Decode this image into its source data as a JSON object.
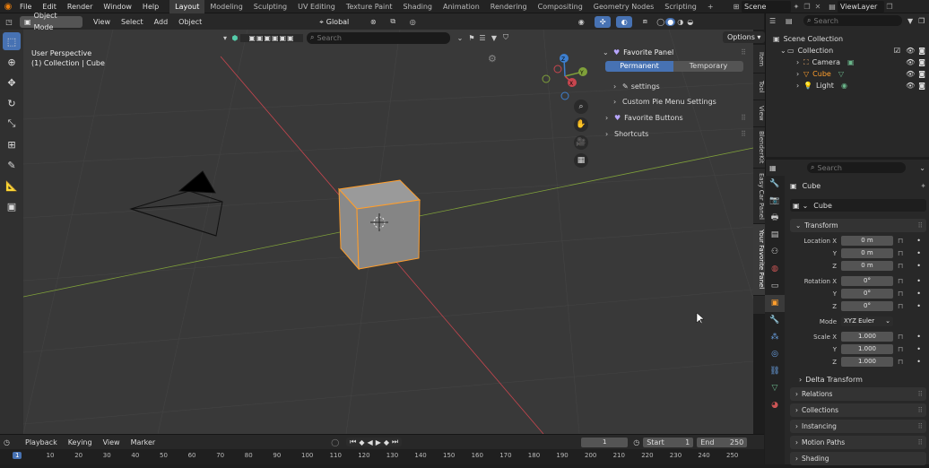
{
  "topbar": {
    "menus": [
      "File",
      "Edit",
      "Render",
      "Window",
      "Help"
    ],
    "workspaces": [
      "Layout",
      "Modeling",
      "Sculpting",
      "UV Editing",
      "Texture Paint",
      "Shading",
      "Animation",
      "Rendering",
      "Compositing",
      "Geometry Nodes",
      "Scripting"
    ],
    "active_workspace": "Layout",
    "plus": "+",
    "scene": "Scene",
    "view_layer": "ViewLayer"
  },
  "viewport_header": {
    "mode": "Object Mode",
    "menus": [
      "View",
      "Select",
      "Add",
      "Object"
    ],
    "orientation": "Global",
    "search_placeholder": "Search",
    "options": "Options"
  },
  "viewport": {
    "view_name": "User Perspective",
    "context": "(1) Collection | Cube",
    "gizmo_axes": [
      "X",
      "Y",
      "Z"
    ]
  },
  "favorite_panel": {
    "title": "Favorite Panel",
    "tabs": [
      "Permanent",
      "Temporary"
    ],
    "active_tab": "Permanent",
    "items": [
      "settings",
      "Custom Pie Menu Settings",
      "Favorite Buttons",
      "Shortcuts"
    ]
  },
  "side_tabs": [
    "Item",
    "Tool",
    "View",
    "BlenderKit",
    "Easy Car Panel",
    "Your Favorite Panel"
  ],
  "outliner": {
    "search_placeholder": "Search",
    "root": "Scene Collection",
    "collection": "Collection",
    "objects": [
      "Camera",
      "Cube",
      "Light"
    ],
    "active_object": "Cube"
  },
  "properties": {
    "search_placeholder": "Search",
    "object_name": "Cube",
    "data_name": "Cube",
    "transform_title": "Transform",
    "location_label": "Location X",
    "rotation_label": "Rotation X",
    "scale_label": "Scale X",
    "mode_label": "Mode",
    "axis_y": "Y",
    "axis_z": "Z",
    "location": [
      "0 m",
      "0 m",
      "0 m"
    ],
    "rotation": [
      "0°",
      "0°",
      "0°"
    ],
    "rotation_mode": "XYZ Euler",
    "scale": [
      "1.000",
      "1.000",
      "1.000"
    ],
    "delta_transform": "Delta Transform",
    "sections": [
      "Relations",
      "Collections",
      "Instancing",
      "Motion Paths",
      "Shading"
    ]
  },
  "timeline": {
    "menus": [
      "Playback",
      "Keying",
      "View",
      "Marker"
    ],
    "current_frame": "1",
    "start_label": "Start",
    "start": "1",
    "end_label": "End",
    "end": "250",
    "ticks": [
      "1",
      "10",
      "20",
      "30",
      "40",
      "50",
      "60",
      "70",
      "80",
      "90",
      "100",
      "110",
      "120",
      "130",
      "140",
      "150",
      "160",
      "170",
      "180",
      "190",
      "200",
      "210",
      "220",
      "230",
      "240",
      "250"
    ]
  },
  "colors": {
    "accent": "#4772b3",
    "selected_orange": "#ff9e2c",
    "viewport_bg": "#393939",
    "x_axis": "#c8464f",
    "y_axis": "#7fa03a"
  }
}
